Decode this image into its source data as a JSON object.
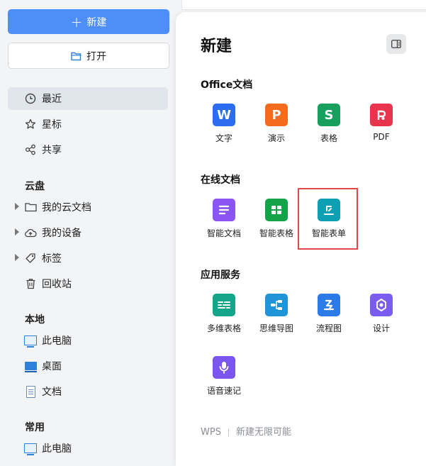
{
  "sidebar": {
    "new_label": "新建",
    "open_label": "打开",
    "items": [
      {
        "label": "最近"
      },
      {
        "label": "星标"
      },
      {
        "label": "共享"
      }
    ],
    "cloud": {
      "title": "云盘",
      "items": [
        {
          "label": "我的云文档"
        },
        {
          "label": "我的设备"
        },
        {
          "label": "标签"
        },
        {
          "label": "回收站"
        }
      ]
    },
    "local": {
      "title": "本地",
      "items": [
        {
          "label": "此电脑"
        },
        {
          "label": "桌面"
        },
        {
          "label": "文档"
        }
      ]
    },
    "common": {
      "title": "常用",
      "items": [
        {
          "label": "此电脑"
        }
      ]
    }
  },
  "panel": {
    "title": "新建",
    "office": {
      "title": "Office文档",
      "apps": [
        {
          "label": "文字",
          "glyph": "W",
          "color": "#2b6cf0"
        },
        {
          "label": "演示",
          "glyph": "P",
          "color": "#f36b1c"
        },
        {
          "label": "表格",
          "glyph": "S",
          "color": "#17a05d"
        },
        {
          "label": "PDF",
          "glyph": "",
          "color": "#e8344c"
        }
      ]
    },
    "online": {
      "title": "在线文档",
      "apps": [
        {
          "label": "智能文档",
          "color": "#8a55f2"
        },
        {
          "label": "智能表格",
          "color": "#15a34a"
        },
        {
          "label": "智能表单",
          "color": "#0e9fb3"
        }
      ]
    },
    "services": {
      "title": "应用服务",
      "apps": [
        {
          "label": "多维表格",
          "color": "#14a58a"
        },
        {
          "label": "思维导图",
          "color": "#1f94d6"
        },
        {
          "label": "流程图",
          "color": "#2b7ae8"
        },
        {
          "label": "设计",
          "color": "#7b5cf0"
        },
        {
          "label": "语音速记",
          "color": "#7a55ee"
        }
      ]
    },
    "footer": {
      "brand": "WPS",
      "slogan": "新建无限可能"
    }
  }
}
